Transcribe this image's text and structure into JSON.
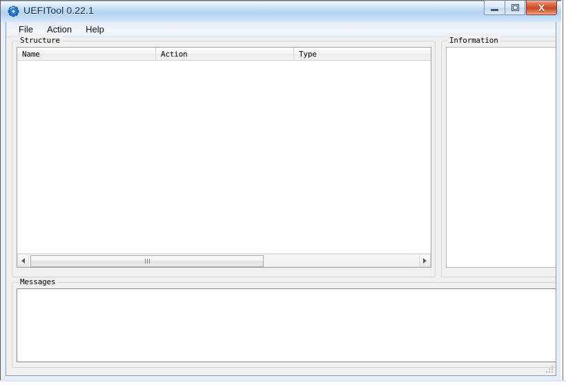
{
  "window": {
    "title": "UEFITool 0.22.1",
    "icon": "gear-icon",
    "controls": {
      "minimize_label": "─",
      "maximize_label": "□",
      "close_label": "X"
    }
  },
  "menubar": {
    "items": [
      {
        "label": "File"
      },
      {
        "label": "Action"
      },
      {
        "label": "Help"
      }
    ]
  },
  "structure": {
    "group_label": "Structure",
    "columns": [
      {
        "label": "Name"
      },
      {
        "label": "Action"
      },
      {
        "label": "Type"
      }
    ],
    "rows": [],
    "hscroll": {
      "left_arrow": "◀",
      "right_arrow": "▶",
      "thumb_grip": "|||"
    }
  },
  "information": {
    "group_label": "Information",
    "content": ""
  },
  "messages": {
    "group_label": "Messages",
    "content": ""
  },
  "colors": {
    "titlebar_blue": "#b7d4f0",
    "frame_blue": "#cfe2f6",
    "client_gray": "#f0f0f0",
    "close_red": "#cf4f2c",
    "text_dark": "#0d2a4e"
  }
}
